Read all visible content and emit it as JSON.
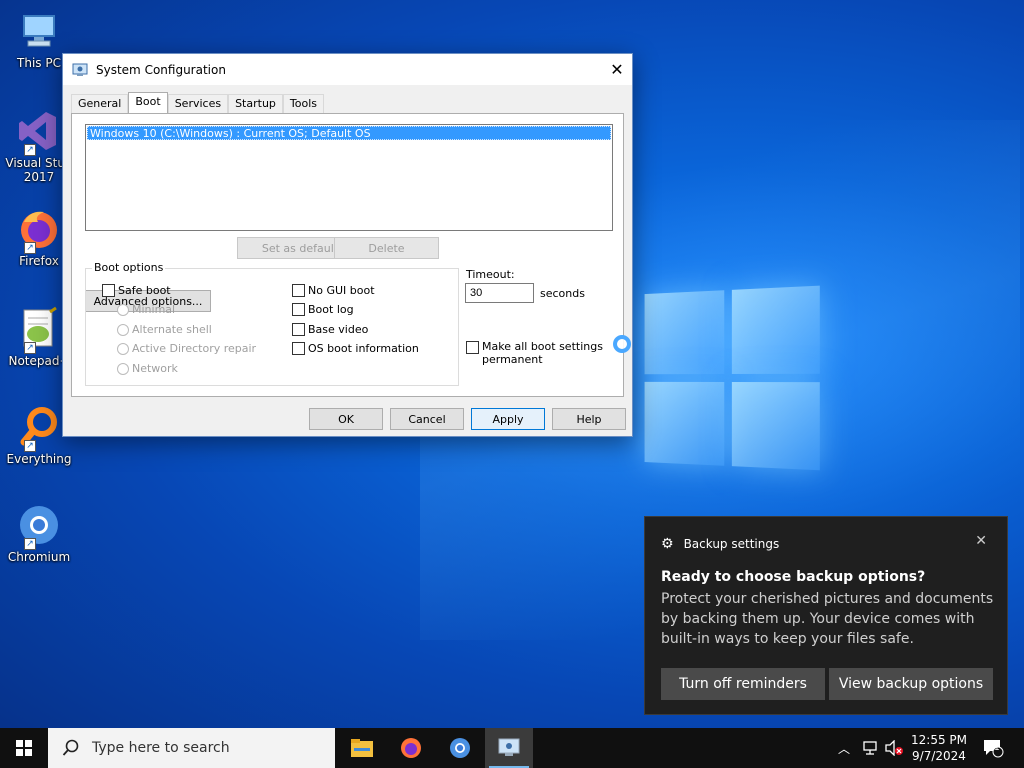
{
  "desktop": {
    "icons": [
      {
        "label": "This PC",
        "icon": "computer-icon"
      },
      {
        "label": "Visual Studio 2017",
        "icon": "visual-studio-icon"
      },
      {
        "label": "Firefox",
        "icon": "firefox-icon"
      },
      {
        "label": "Notepad++",
        "icon": "notepad-plus-plus-icon"
      },
      {
        "label": "Everything",
        "icon": "everything-search-icon"
      },
      {
        "label": "Chromium",
        "icon": "chromium-icon"
      }
    ],
    "icon_labels_shown": [
      "This PC",
      "Visual Stud\n2017",
      "Firefox",
      "Notepad+",
      "Everything",
      "Chromium"
    ]
  },
  "dialog": {
    "title": "System Configuration",
    "tabs": [
      "General",
      "Boot",
      "Services",
      "Startup",
      "Tools"
    ],
    "active_tab": "Boot",
    "os_list": [
      "Windows 10 (C:\\Windows) : Current OS; Default OS"
    ],
    "buttons": {
      "advanced": "Advanced options...",
      "set_default": "Set as default",
      "delete": "Delete"
    },
    "boot_options": {
      "legend": "Boot options",
      "safe_boot": {
        "label": "Safe boot",
        "checked": false
      },
      "radios": [
        "Minimal",
        "Alternate shell",
        "Active Directory repair",
        "Network"
      ],
      "checkboxes": [
        {
          "label": "No GUI boot",
          "checked": false
        },
        {
          "label": "Boot log",
          "checked": false
        },
        {
          "label": "Base video",
          "checked": false
        },
        {
          "label": "OS boot information",
          "checked": false
        }
      ]
    },
    "timeout": {
      "label": "Timeout:",
      "value": "30",
      "unit": "seconds"
    },
    "make_permanent": {
      "label_line1": "Make all boot settings",
      "label_line2": "permanent",
      "checked": false
    },
    "footer": {
      "ok": "OK",
      "cancel": "Cancel",
      "apply": "Apply",
      "help": "Help"
    }
  },
  "notification": {
    "app": "Backup settings",
    "headline": "Ready to choose backup options?",
    "body": "Protect your cherished pictures and documents by backing them up. Your device comes with built-in ways to keep your files safe.",
    "btn_off": "Turn off reminders",
    "btn_view": "View backup options"
  },
  "taskbar": {
    "search_placeholder": "Type here to search",
    "apps": [
      "file-explorer-icon",
      "firefox-icon",
      "chromium-icon",
      "system-configuration-icon"
    ],
    "time": "12:55 PM",
    "date": "9/7/2024",
    "notification_count": "1"
  },
  "colors": {
    "accent": "#0078d7",
    "selection": "#3399ff",
    "toast_bg": "#1f1f1f"
  }
}
